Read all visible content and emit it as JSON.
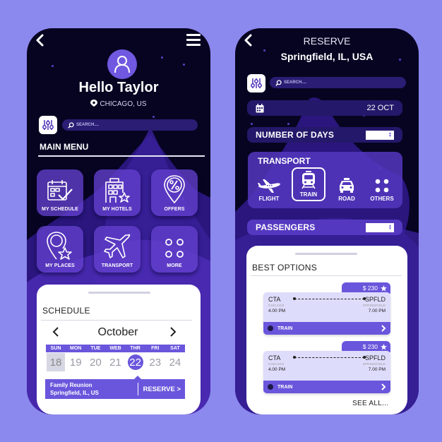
{
  "colors": {
    "background": "#8b88ee",
    "phone_bg": "#070422",
    "accent": "#6a56dc",
    "tile": "#6340cd",
    "ticket": "#dedcfb"
  },
  "left_screen": {
    "back_icon": "chevron-left-icon",
    "menu_icon": "hamburger-menu-icon",
    "avatar_icon": "user-icon",
    "greeting": "Hello Taylor",
    "location": "CHICAGO, US",
    "location_icon": "map-pin-icon",
    "filter_icon": "sliders-icon",
    "search": {
      "placeholder": "SEARCH....",
      "icon": "search-icon"
    },
    "main_menu": {
      "title": "MAIN MENU",
      "items": [
        {
          "label": "MY SCHEDULE",
          "icon": "calendar-check-icon"
        },
        {
          "label": "MY HOTELS",
          "icon": "hotel-star-icon"
        },
        {
          "label": "OFFERS",
          "icon": "percent-pin-icon"
        },
        {
          "label": "MY PLACES",
          "icon": "pin-star-icon"
        },
        {
          "label": "TRANSPORT",
          "icon": "airplane-icon"
        },
        {
          "label": "MORE",
          "icon": "dots-grid-icon"
        }
      ]
    },
    "schedule": {
      "title": "SCHEDULE",
      "month": "October",
      "prev_icon": "chevron-left-icon",
      "next_icon": "chevron-right-icon",
      "weekdays": [
        "SUN",
        "MON",
        "TUE",
        "WEB",
        "THR",
        "FRI",
        "SAT"
      ],
      "dates": [
        "18",
        "19",
        "20",
        "21",
        "22",
        "23",
        "24"
      ],
      "today": "18",
      "selected": "22",
      "event": {
        "title": "Family Reunion",
        "location": "Springfield, IL, US",
        "action": "RESERVE >"
      }
    }
  },
  "right_screen": {
    "back_icon": "chevron-left-icon",
    "title": "RESERVE",
    "destination": "Springfield, IL, USA",
    "filter_icon": "sliders-icon",
    "search": {
      "placeholder": "SEARCH....",
      "icon": "search-icon"
    },
    "date": {
      "icon": "calendar-icon",
      "value": "22 OCT"
    },
    "number_of_days": {
      "label": "NUMBER OF DAYS",
      "value": ""
    },
    "transport": {
      "title": "TRANSPORT",
      "modes": [
        {
          "label": "FLIGHT",
          "icon": "airplane-icon",
          "selected": false
        },
        {
          "label": "TRAIN",
          "icon": "train-icon",
          "selected": true
        },
        {
          "label": "ROAD",
          "icon": "taxi-icon",
          "selected": false
        },
        {
          "label": "OTHERS",
          "icon": "dots-grid-icon",
          "selected": false
        }
      ]
    },
    "passengers": {
      "label": "PASSENGERS",
      "value": ""
    },
    "best_options": {
      "title": "BEST OPTIONS",
      "options": [
        {
          "price": "$ 230",
          "from_code": "CTA",
          "from_city": "CHICAGO",
          "depart": "4.00 PM",
          "to_code": "SPFLD",
          "to_city": "SPRINGFIELD",
          "arrive": "7.00 PM",
          "mode": "TRAIN"
        },
        {
          "price": "$ 230",
          "from_code": "CTA",
          "from_city": "CHICAGO",
          "depart": "4.00 PM",
          "to_code": "SPFLD",
          "to_city": "SPRINGFIELD",
          "arrive": "7.00 PM",
          "mode": "TRAIN"
        }
      ],
      "see_all": "SEE ALL..."
    }
  }
}
